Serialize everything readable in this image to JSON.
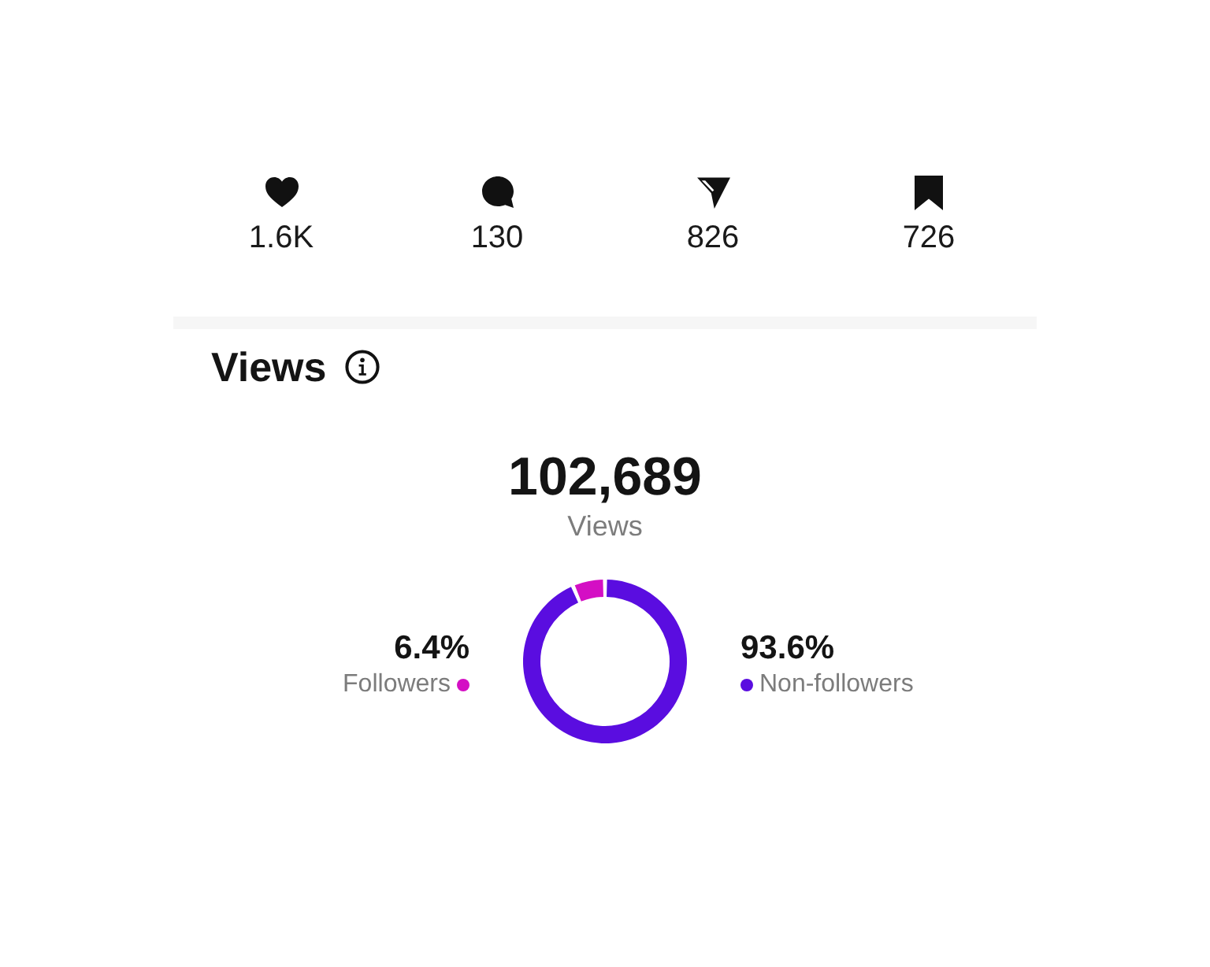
{
  "stats": [
    {
      "kind": "likes",
      "value": "1.6K"
    },
    {
      "kind": "comments",
      "value": "130"
    },
    {
      "kind": "shares",
      "value": "826"
    },
    {
      "kind": "saves",
      "value": "726"
    }
  ],
  "views": {
    "title": "Views",
    "total": "102,689",
    "total_label": "Views",
    "chart_data": {
      "type": "donut",
      "categories": [
        "Followers",
        "Non-followers"
      ],
      "values": [
        6.4,
        93.6
      ]
    },
    "legend": [
      {
        "percent": "6.4%",
        "color": "#d40fc4"
      },
      {
        "percent": "93.6%",
        "color": "#5a0de0"
      }
    ]
  }
}
